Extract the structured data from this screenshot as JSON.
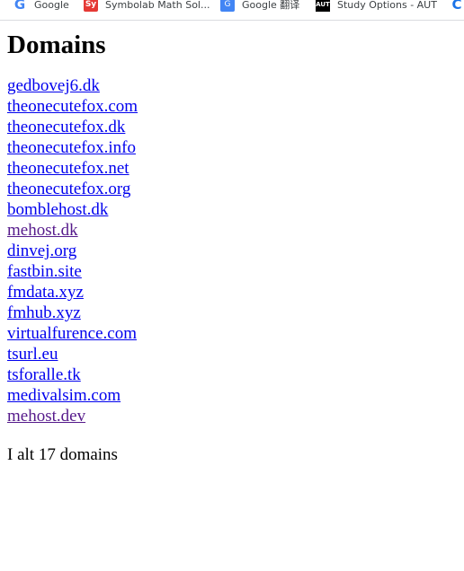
{
  "bookmarks": [
    {
      "label": "Google",
      "icon": "google-icon"
    },
    {
      "label": "Symbolab Math Sol...",
      "icon": "symbolab-icon"
    },
    {
      "label": "Google 翻译",
      "icon": "google-translate-icon"
    },
    {
      "label": "Study Options - AUT",
      "icon": "aut-icon"
    },
    {
      "label": "",
      "icon": "c-icon"
    }
  ],
  "page": {
    "heading": "Domains",
    "total_text": "I alt 17 domains"
  },
  "domains": [
    {
      "name": "gedbovej6.dk",
      "visited": false
    },
    {
      "name": "theonecutefox.com",
      "visited": false
    },
    {
      "name": "theonecutefox.dk",
      "visited": false
    },
    {
      "name": "theonecutefox.info",
      "visited": false
    },
    {
      "name": "theonecutefox.net",
      "visited": false
    },
    {
      "name": "theonecutefox.org",
      "visited": false
    },
    {
      "name": "bomblehost.dk",
      "visited": false
    },
    {
      "name": "mehost.dk",
      "visited": true
    },
    {
      "name": "dinvej.org",
      "visited": false
    },
    {
      "name": "fastbin.site",
      "visited": false
    },
    {
      "name": "fmdata.xyz",
      "visited": false
    },
    {
      "name": "fmhub.xyz",
      "visited": false
    },
    {
      "name": "virtualfurence.com",
      "visited": false
    },
    {
      "name": "tsurl.eu",
      "visited": false
    },
    {
      "name": "tsforalle.tk",
      "visited": false
    },
    {
      "name": "medivalsim.com",
      "visited": false
    },
    {
      "name": "mehost.dev",
      "visited": true
    }
  ],
  "colors": {
    "link": "#0000ee",
    "visited_link": "#551a8b"
  }
}
